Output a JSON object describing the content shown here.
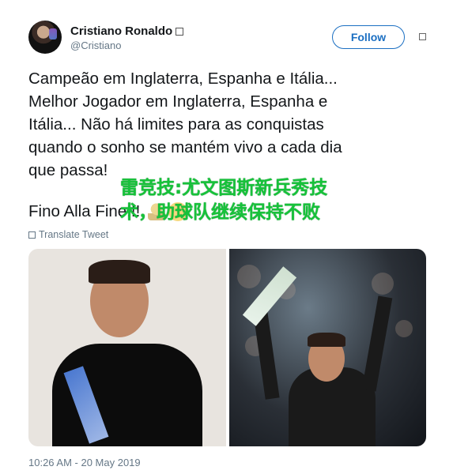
{
  "tweet": {
    "display_name": "Cristiano Ronaldo",
    "handle": "@Cristiano",
    "follow_label": "Follow",
    "text_lines": [
      "Campeão em Inglaterra, Espanha e Itália...",
      "Melhor Jogador em Inglaterra, Espanha e",
      "Itália... Não há limites para as conquistas",
      "quando o sonho se mantém vivo a cada dia",
      "que passa!"
    ],
    "closing_line": "Fino Alla Fine!!!",
    "translate_label": "Translate Tweet",
    "timestamp": "10:26 AM - 20 May 2019"
  },
  "overlay": {
    "text": "雷竞技:尤文图斯新兵秀技术，助球队继续保持不败"
  },
  "icons": {
    "verified": "verified-icon",
    "menu": "menu-icon",
    "translate": "globe-icon"
  },
  "colors": {
    "follow_accent": "#1b6fc2",
    "overlay_green": "#16c23a",
    "secondary_text": "#657786"
  }
}
